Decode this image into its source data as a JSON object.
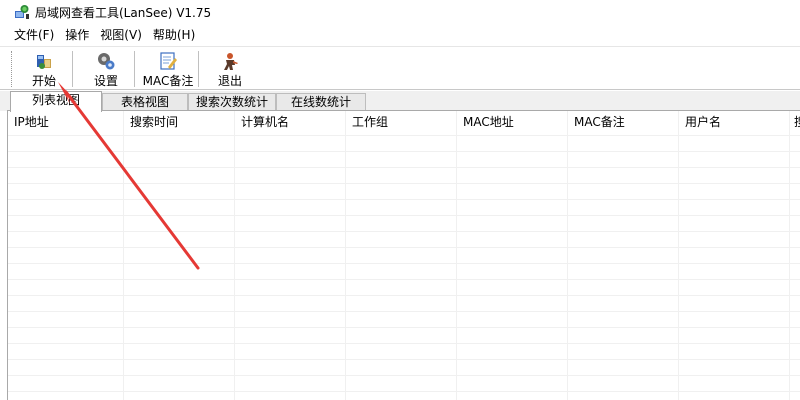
{
  "window": {
    "title": "局域网查看工具(LanSee) V1.75"
  },
  "menu": {
    "items": [
      {
        "label": "文件(F)"
      },
      {
        "label": "操作"
      },
      {
        "label": "视图(V)"
      },
      {
        "label": "帮助(H)"
      }
    ]
  },
  "toolbar": {
    "buttons": [
      {
        "label": "开始",
        "icon": "start-icon"
      },
      {
        "label": "设置",
        "icon": "settings-icon"
      },
      {
        "label": "MAC备注",
        "icon": "mac-note-icon"
      },
      {
        "label": "退出",
        "icon": "exit-icon"
      }
    ]
  },
  "tabs": [
    {
      "label": "列表视图",
      "active": true
    },
    {
      "label": "表格视图",
      "active": false
    },
    {
      "label": "搜索次数统计",
      "active": false
    },
    {
      "label": "在线数统计",
      "active": false
    }
  ],
  "table": {
    "columns": [
      "IP地址",
      "搜索时间",
      "计算机名",
      "工作组",
      "MAC地址",
      "MAC备注",
      "用户名",
      "搜"
    ]
  },
  "colors": {
    "arrow": "#e53935"
  }
}
